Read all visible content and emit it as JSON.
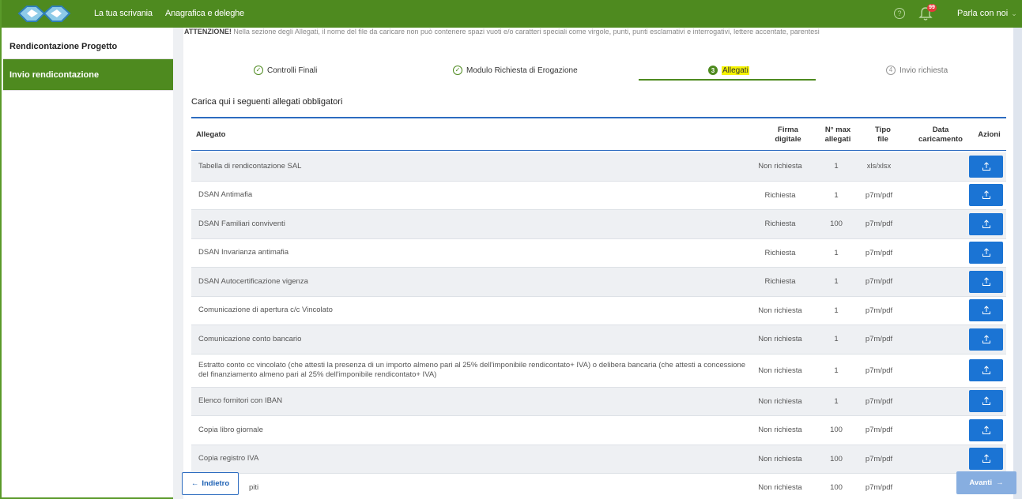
{
  "header": {
    "nav": [
      "La tua scrivania",
      "Anagrafica e deleghe"
    ],
    "help_icon": "?",
    "notification_count": "99",
    "user_menu": "Parla con noi",
    "chevron": "⌄"
  },
  "sidebar": {
    "items": [
      {
        "label": "Rendicontazione Progetto"
      },
      {
        "label": "Invio rendicontazione"
      }
    ]
  },
  "warning": {
    "strong": "ATTENZIONE!",
    "text": " Nella sezione degli Allegati, il nome del file da caricare non può contenere spazi vuoti e/o caratteri speciali come virgole, punti, punti esclamativi e interrogativi, lettere accentate, parentesi"
  },
  "stepper": {
    "steps": [
      {
        "label": "Controlli Finali",
        "marker": "✓"
      },
      {
        "label": "Modulo Richiesta di Erogazione",
        "marker": "✓"
      },
      {
        "label": "Allegati",
        "marker": "3"
      },
      {
        "label": "Invio richiesta",
        "marker": "4"
      }
    ]
  },
  "section": {
    "title": "Carica qui i seguenti allegati obbligatori"
  },
  "table": {
    "headers": {
      "allegato": "Allegato",
      "firma_1": "Firma",
      "firma_2": "digitale",
      "max_1": "N° max",
      "max_2": "allegati",
      "tipo_1": "Tipo",
      "tipo_2": "file",
      "data_1": "Data",
      "data_2": "caricamento",
      "azioni": "Azioni"
    },
    "rows": [
      {
        "name": "Tabella di rendicontazione SAL",
        "firma": "Non richiesta",
        "max": "1",
        "tipo": "xls/xlsx"
      },
      {
        "name": "DSAN Antimafia",
        "firma": "Richiesta",
        "max": "1",
        "tipo": "p7m/pdf"
      },
      {
        "name": "DSAN Familiari conviventi",
        "firma": "Richiesta",
        "max": "100",
        "tipo": "p7m/pdf"
      },
      {
        "name": "DSAN Invarianza antimafia",
        "firma": "Richiesta",
        "max": "1",
        "tipo": "p7m/pdf"
      },
      {
        "name": "DSAN Autocertificazione vigenza",
        "firma": "Richiesta",
        "max": "1",
        "tipo": "p7m/pdf"
      },
      {
        "name": "Comunicazione di apertura c/c Vincolato",
        "firma": "Non richiesta",
        "max": "1",
        "tipo": "p7m/pdf"
      },
      {
        "name": "Comunicazione conto bancario",
        "firma": "Non richiesta",
        "max": "1",
        "tipo": "p7m/pdf"
      },
      {
        "name": "Estratto conto cc vincolato (che attesti la presenza di un importo almeno pari al 25% dell'imponibile rendicontato+ IVA) o delibera bancaria (che attesti a concessione del finanziamento almeno pari al 25% dell'imponibile rendicontato+ IVA)",
        "firma": "Non richiesta",
        "max": "1",
        "tipo": "p7m/pdf"
      },
      {
        "name": "Elenco fornitori con IBAN",
        "firma": "Non richiesta",
        "max": "1",
        "tipo": "p7m/pdf"
      },
      {
        "name": "Copia libro giornale",
        "firma": "Non richiesta",
        "max": "100",
        "tipo": "p7m/pdf"
      },
      {
        "name": "Copia registro IVA",
        "firma": "Non richiesta",
        "max": "100",
        "tipo": "p7m/pdf"
      },
      {
        "name": "piti",
        "firma": "Non richiesta",
        "max": "100",
        "tipo": "p7m/pdf"
      }
    ]
  },
  "footer": {
    "back_label": "Indietro",
    "back_arrow": "←",
    "next_label": "Avanti",
    "next_arrow": "→"
  },
  "colors": {
    "brand_green": "#4e8a1f",
    "primary_blue": "#1b74d4",
    "highlight": "#f5f300"
  }
}
